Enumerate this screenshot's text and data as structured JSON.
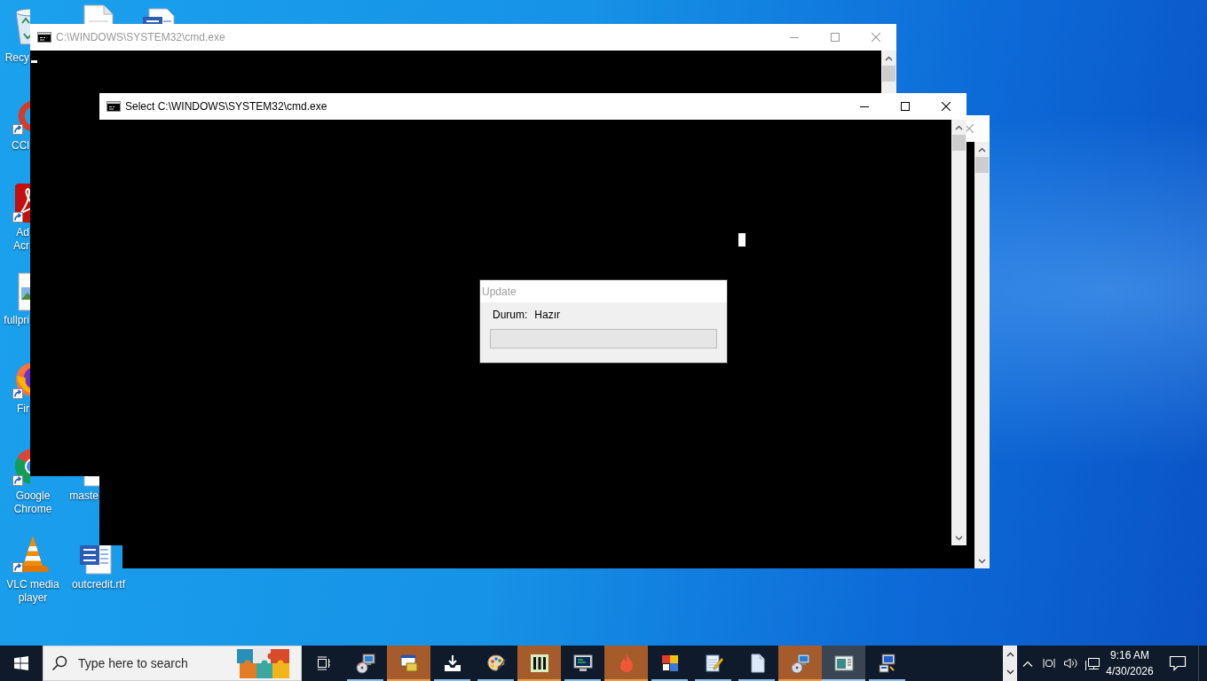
{
  "desktop_icons": [
    {
      "kind": "recycle-bin",
      "label_lines": [
        "Recy"
      ],
      "shortcut": false
    },
    {
      "kind": "cleaner",
      "label_lines": [
        "CCl"
      ],
      "shortcut": true
    },
    {
      "kind": "pdf",
      "label_lines": [
        "Ad",
        "Acr"
      ],
      "shortcut": true
    },
    {
      "kind": "image-file",
      "label_lines": [
        "fullpri"
      ],
      "shortcut": false
    },
    {
      "kind": "firefox",
      "label_lines": [
        "Fir"
      ],
      "shortcut": true
    },
    {
      "kind": "chrome",
      "label_lines": [
        "Google",
        "Chrome"
      ],
      "shortcut": true
    },
    {
      "kind": "vlc",
      "label_lines": [
        "VLC media",
        "player"
      ],
      "shortcut": true
    },
    {
      "kind": "document",
      "shortcut": false
    },
    {
      "kind": "word-document",
      "shortcut": false
    },
    {
      "kind": "document",
      "label_lines": [
        "maste"
      ],
      "shortcut": false
    },
    {
      "kind": "word-document",
      "label_lines": [
        "outcredit.rtf"
      ],
      "shortcut": false
    }
  ],
  "windows": [
    {
      "kind": "console",
      "title": "C:\\WINDOWS\\SYSTEM32\\cmd.exe",
      "active": false,
      "controls": [
        {
          "kind": "minimize"
        },
        {
          "kind": "maximize"
        },
        {
          "kind": "close"
        }
      ]
    },
    {
      "kind": "console",
      "title": "Select C:\\WINDOWS\\SYSTEM32\\cmd.exe",
      "active": true,
      "controls": [
        {
          "kind": "minimize"
        },
        {
          "kind": "maximize"
        },
        {
          "kind": "close"
        }
      ]
    },
    {
      "kind": "console",
      "active": false,
      "controls": [
        {
          "kind": "close"
        }
      ]
    },
    {
      "kind": "dialog",
      "title": "Update",
      "active": false,
      "fields": [
        {
          "label": "Durum:",
          "value": "Hazır"
        }
      ],
      "progress": {
        "level": 0
      }
    }
  ],
  "taskbar": {
    "search": {
      "placeholder": "Type here to search"
    },
    "apps": [
      {
        "kind": "installer",
        "flashing": false,
        "selected": false
      },
      {
        "kind": "package",
        "flashing": true,
        "selected": false
      },
      {
        "kind": "download",
        "flashing": false,
        "selected": false
      },
      {
        "kind": "palette",
        "flashing": false,
        "selected": false
      },
      {
        "kind": "bars",
        "flashing": true,
        "selected": false
      },
      {
        "kind": "terminal",
        "flashing": false,
        "selected": false
      },
      {
        "kind": "flame",
        "flashing": true,
        "selected": false
      },
      {
        "kind": "tiles",
        "flashing": false,
        "selected": false
      },
      {
        "kind": "notepad",
        "flashing": false,
        "selected": false
      },
      {
        "kind": "document",
        "flashing": false,
        "selected": false
      },
      {
        "kind": "installer",
        "flashing": true,
        "selected": false
      },
      {
        "kind": "window",
        "flashing": false,
        "selected": true
      },
      {
        "kind": "computer",
        "flashing": false,
        "selected": false
      }
    ],
    "clock": {
      "time": "9:16 AM",
      "date": "4/30/2026"
    }
  }
}
